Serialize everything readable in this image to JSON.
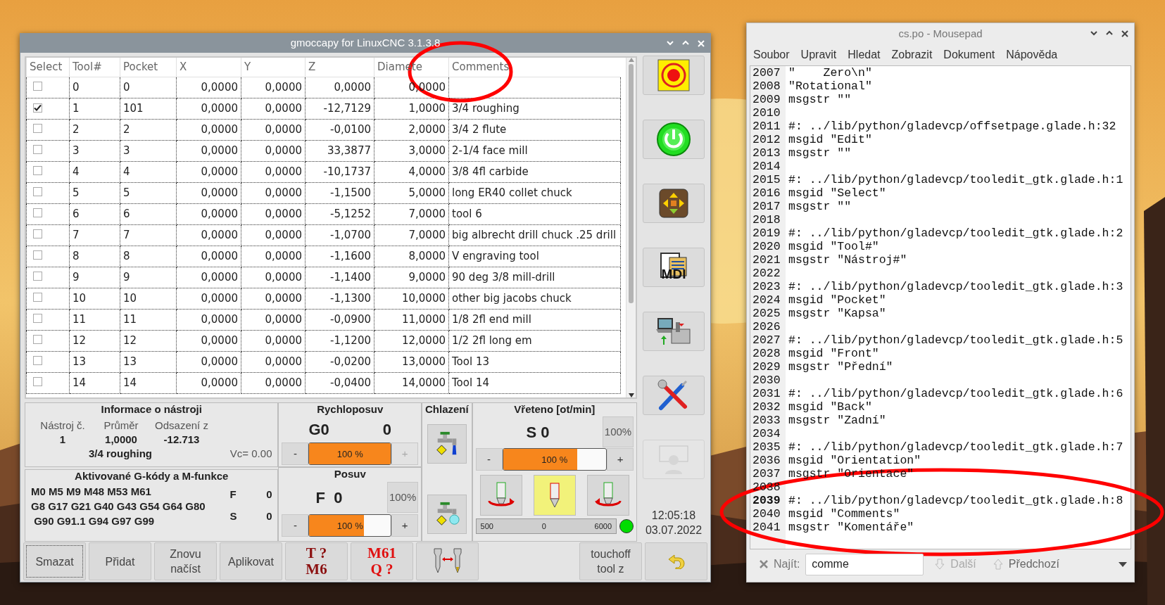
{
  "gmoccapy": {
    "title": "gmoccapy for LinuxCNC  3.1.3.8",
    "table": {
      "select_column": "Select",
      "columns": [
        "Tool#",
        "Pocket",
        "X",
        "Y",
        "Z",
        "Diamete",
        "Comments"
      ],
      "rows": [
        {
          "checked": false,
          "cells": [
            "0",
            "0",
            "0,0000",
            "0,0000",
            "0,0000",
            "0,0000"
          ]
        },
        {
          "checked": true,
          "cells": [
            "1",
            "101",
            "0,0000",
            "0,0000",
            "-12,7129",
            "1,0000",
            "3/4 roughing"
          ]
        },
        {
          "checked": false,
          "cells": [
            "2",
            "2",
            "0,0000",
            "0,0000",
            "-0,0100",
            "2,0000",
            "3/4 2 flute"
          ]
        },
        {
          "checked": false,
          "cells": [
            "3",
            "3",
            "0,0000",
            "0,0000",
            "33,3877",
            "3,0000",
            "2-1/4 face mill"
          ]
        },
        {
          "checked": false,
          "cells": [
            "4",
            "4",
            "0,0000",
            "0,0000",
            "-10,1737",
            "4,0000",
            "3/8 4fl carbide"
          ]
        },
        {
          "checked": false,
          "cells": [
            "5",
            "5",
            "0,0000",
            "0,0000",
            "-1,1500",
            "5,0000",
            "long ER40 collet chuck"
          ]
        },
        {
          "checked": false,
          "cells": [
            "6",
            "6",
            "0,0000",
            "0,0000",
            "-5,1252",
            "7,0000",
            "tool 6"
          ]
        },
        {
          "checked": false,
          "cells": [
            "7",
            "7",
            "0,0000",
            "0,0000",
            "-1,0700",
            "7,0000",
            "big albrecht drill chuck .25 drill"
          ]
        },
        {
          "checked": false,
          "cells": [
            "8",
            "8",
            "0,0000",
            "0,0000",
            "-1,1600",
            "8,0000",
            "V engraving tool"
          ]
        },
        {
          "checked": false,
          "cells": [
            "9",
            "9",
            "0,0000",
            "0,0000",
            "-1,1400",
            "9,0000",
            "90 deg 3/8 mill-drill"
          ]
        },
        {
          "checked": false,
          "cells": [
            "10",
            "10",
            "0,0000",
            "0,0000",
            "-1,1300",
            "10,0000",
            "other big jacobs chuck"
          ]
        },
        {
          "checked": false,
          "cells": [
            "11",
            "11",
            "0,0000",
            "0,0000",
            "-0,0900",
            "11,0000",
            "1/8 2fl end mill"
          ]
        },
        {
          "checked": false,
          "cells": [
            "12",
            "12",
            "0,0000",
            "0,0000",
            "-1,1200",
            "12,0000",
            "1/2 2fl long em"
          ]
        },
        {
          "checked": false,
          "cells": [
            "13",
            "13",
            "0,0000",
            "0,0000",
            "-0,0200",
            "13,0000",
            "Tool 13"
          ]
        },
        {
          "checked": false,
          "cells": [
            "14",
            "14",
            "0,0000",
            "0,0000",
            "-0,0400",
            "14,0000",
            "Tool 14"
          ]
        }
      ]
    },
    "side_buttons": [
      {
        "kind": "estop",
        "disabled": false
      },
      {
        "kind": "power",
        "disabled": false
      },
      {
        "kind": "jog",
        "disabled": false
      },
      {
        "kind": "mdi",
        "label": "MDI",
        "disabled": false
      },
      {
        "kind": "auto",
        "disabled": false
      },
      {
        "kind": "settings",
        "disabled": false
      },
      {
        "kind": "user",
        "disabled": true
      }
    ],
    "tool_info": {
      "title": "Informace o nástroji",
      "labels": [
        "Nástroj č.",
        "Průměr",
        "Odsazení z"
      ],
      "values": [
        "1",
        "1,0000",
        "-12.713"
      ],
      "comment": "3/4 roughing",
      "vc": "Vc= 0.00"
    },
    "gcodes": {
      "title": "Aktivované G-kódy a M-funkce",
      "lines": [
        "M0 M5 M9 M48 M53 M61",
        "G8 G17 G21 G40 G43 G54 G64 G80",
        " G90 G91.1 G94 G97 G99"
      ],
      "pairs": [
        {
          "label": "F",
          "value": "0"
        },
        {
          "label": "S",
          "value": "0"
        }
      ]
    },
    "rapid": {
      "title": "Rychloposuv",
      "code": "G0",
      "value": "0",
      "level": 1.0,
      "reading": "100 %",
      "minus": {
        "label": "-",
        "disabled": false
      },
      "plus": {
        "label": "+",
        "disabled": true
      }
    },
    "feed": {
      "title": "Posuv",
      "code": "F  0",
      "override": "100%",
      "level": 0.67,
      "reading": "100 %",
      "minus": {
        "label": "-",
        "disabled": false
      },
      "plus": {
        "label": "+",
        "disabled": false
      }
    },
    "coolant": {
      "title": "Chlazení",
      "buttons": [
        {
          "kind": "flood"
        },
        {
          "kind": "mist"
        }
      ]
    },
    "spindle": {
      "title": "Vřeteno [ot/min]",
      "code": "S 0",
      "override": "100%",
      "level": 0.72,
      "reading": "100 %",
      "minus": {
        "label": "-",
        "disabled": false
      },
      "plus": {
        "label": "+",
        "disabled": false
      },
      "buttons": [
        {
          "kind": "forward",
          "selected": false
        },
        {
          "kind": "stop",
          "selected": true
        },
        {
          "kind": "reverse",
          "selected": false
        }
      ],
      "gauge": [
        "500",
        "0",
        "6000"
      ],
      "at_speed": true
    },
    "clock": {
      "time": "12:05:18",
      "date": "03.07.2022"
    },
    "bottom_buttons": [
      {
        "kind": "text",
        "lines": [
          "Smazat"
        ],
        "focused": true
      },
      {
        "kind": "text",
        "lines": [
          "Přidat"
        ],
        "focused": false
      },
      {
        "kind": "text",
        "lines": [
          "Znovu",
          "načíst"
        ],
        "focused": false
      },
      {
        "kind": "text",
        "lines": [
          "Aplikovat"
        ],
        "focused": false
      },
      {
        "kind": "code",
        "lines": [
          "T ?",
          "M6"
        ],
        "color": "#8b1010",
        "focused": false
      },
      {
        "kind": "code",
        "lines": [
          "M61",
          "Q ?"
        ],
        "color": "#e01010",
        "focused": false
      },
      {
        "kind": "toolchange",
        "focused": false
      },
      {
        "kind": "spacer"
      },
      {
        "kind": "text",
        "lines": [
          "touchoff",
          "tool z"
        ],
        "focused": false
      },
      {
        "kind": "back",
        "focused": false
      }
    ]
  },
  "mousepad": {
    "title": "cs.po - Mousepad",
    "menu": [
      "Soubor",
      "Upravit",
      "Hledat",
      "Zobrazit",
      "Dokument",
      "Nápověda"
    ],
    "lines": [
      {
        "number": "2007",
        "text": "\"    Zero\\n\"",
        "current": false
      },
      {
        "number": "2008",
        "text": "\"Rotational\"",
        "current": false
      },
      {
        "number": "2009",
        "text": "msgstr \"\"",
        "current": false
      },
      {
        "number": "2010",
        "current": false
      },
      {
        "number": "2011",
        "text": "#: ../lib/python/gladevcp/offsetpage.glade.h:32",
        "current": false
      },
      {
        "number": "2012",
        "text": "msgid \"Edit\"",
        "current": false
      },
      {
        "number": "2013",
        "text": "msgstr \"\"",
        "current": false
      },
      {
        "number": "2014",
        "current": false
      },
      {
        "number": "2015",
        "text": "#: ../lib/python/gladevcp/tooledit_gtk.glade.h:1",
        "current": false
      },
      {
        "number": "2016",
        "text": "msgid \"Select\"",
        "current": false
      },
      {
        "number": "2017",
        "text": "msgstr \"\"",
        "current": false
      },
      {
        "number": "2018",
        "current": false
      },
      {
        "number": "2019",
        "text": "#: ../lib/python/gladevcp/tooledit_gtk.glade.h:2",
        "current": false
      },
      {
        "number": "2020",
        "text": "msgid \"Tool#\"",
        "current": false
      },
      {
        "number": "2021",
        "text": "msgstr \"Nástroj#\"",
        "current": false
      },
      {
        "number": "2022",
        "current": false
      },
      {
        "number": "2023",
        "text": "#: ../lib/python/gladevcp/tooledit_gtk.glade.h:3",
        "current": false
      },
      {
        "number": "2024",
        "text": "msgid \"Pocket\"",
        "current": false
      },
      {
        "number": "2025",
        "text": "msgstr \"Kapsa\"",
        "current": false
      },
      {
        "number": "2026",
        "current": false
      },
      {
        "number": "2027",
        "text": "#: ../lib/python/gladevcp/tooledit_gtk.glade.h:5",
        "current": false
      },
      {
        "number": "2028",
        "text": "msgid \"Front\"",
        "current": false
      },
      {
        "number": "2029",
        "text": "msgstr \"Přední\"",
        "current": false
      },
      {
        "number": "2030",
        "current": false
      },
      {
        "number": "2031",
        "text": "#: ../lib/python/gladevcp/tooledit_gtk.glade.h:6",
        "current": false
      },
      {
        "number": "2032",
        "text": "msgid \"Back\"",
        "current": false
      },
      {
        "number": "2033",
        "text": "msgstr \"Zadní\"",
        "current": false
      },
      {
        "number": "2034",
        "current": false
      },
      {
        "number": "2035",
        "text": "#: ../lib/python/gladevcp/tooledit_gtk.glade.h:7",
        "current": false
      },
      {
        "number": "2036",
        "text": "msgid \"Orientation\"",
        "current": false
      },
      {
        "number": "2037",
        "text": "msgstr \"Orientace\"",
        "current": false
      },
      {
        "number": "2038",
        "current": false
      },
      {
        "number": "2039",
        "text": "#: ../lib/python/gladevcp/tooledit_gtk.glade.h:8",
        "current": true
      },
      {
        "number": "2040",
        "text": "msgid \"Comments\"",
        "current": false
      },
      {
        "number": "2041",
        "text": "msgstr \"Komentáře\"",
        "current": false
      }
    ],
    "find": {
      "label": "Najít:",
      "value": "comme",
      "next": {
        "label": "Další",
        "disabled": true
      },
      "previous": {
        "label": "Předchozí",
        "disabled": false
      }
    }
  }
}
